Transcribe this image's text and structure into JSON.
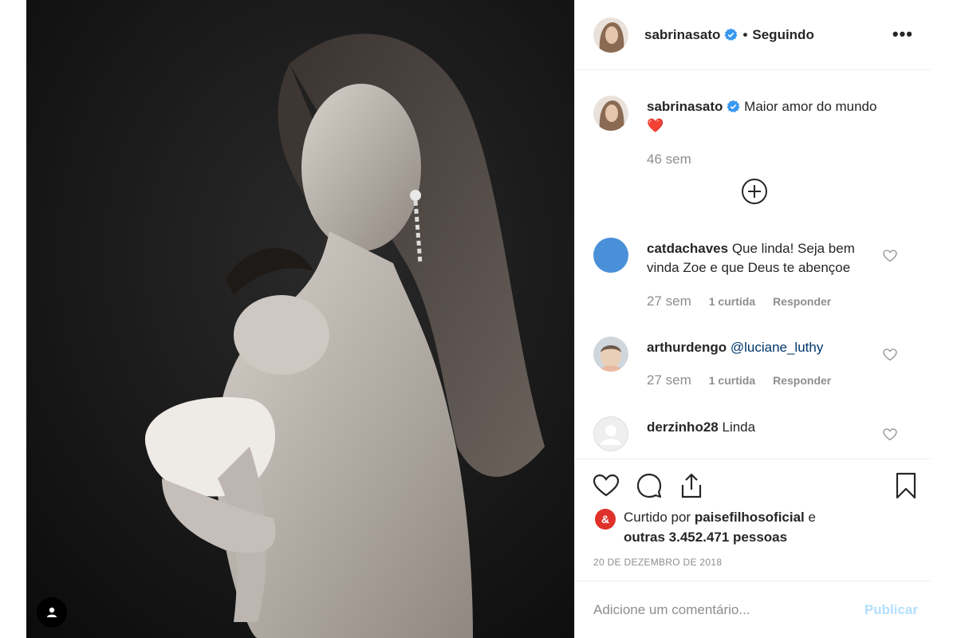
{
  "post": {
    "author": "sabrinasato",
    "separator": "•",
    "follow_status": "Seguindo",
    "more_label": "•••"
  },
  "caption": {
    "username": "sabrinasato",
    "text": "Maior amor do mundo",
    "emoji": "❤️",
    "time": "46 sem"
  },
  "comments": [
    {
      "username": "catdachaves",
      "text": "Que linda! Seja bem vinda Zoe e que Deus te abençoe",
      "time": "27 sem",
      "likes": "1 curtida",
      "reply": "Responder",
      "avatar_color": "#4a90d9"
    },
    {
      "username": "arthurdengo",
      "mention": "@luciane_luthy",
      "time": "27 sem",
      "likes": "1 curtida",
      "reply": "Responder"
    },
    {
      "username": "derzinho28",
      "text": "Linda"
    }
  ],
  "likes": {
    "liker_initial": "&",
    "prefix": "Curtido por",
    "liker": "paisefilhosoficial",
    "conj": "e",
    "others": "outras 3.452.471 pessoas"
  },
  "date": "20 DE DEZEMBRO DE 2018",
  "compose": {
    "placeholder": "Adicione um comentário...",
    "publish": "Publicar"
  },
  "colors": {
    "verified": "#3897f0",
    "publish_disabled": "#b2dffc",
    "liker_badge": "#e0312b"
  }
}
